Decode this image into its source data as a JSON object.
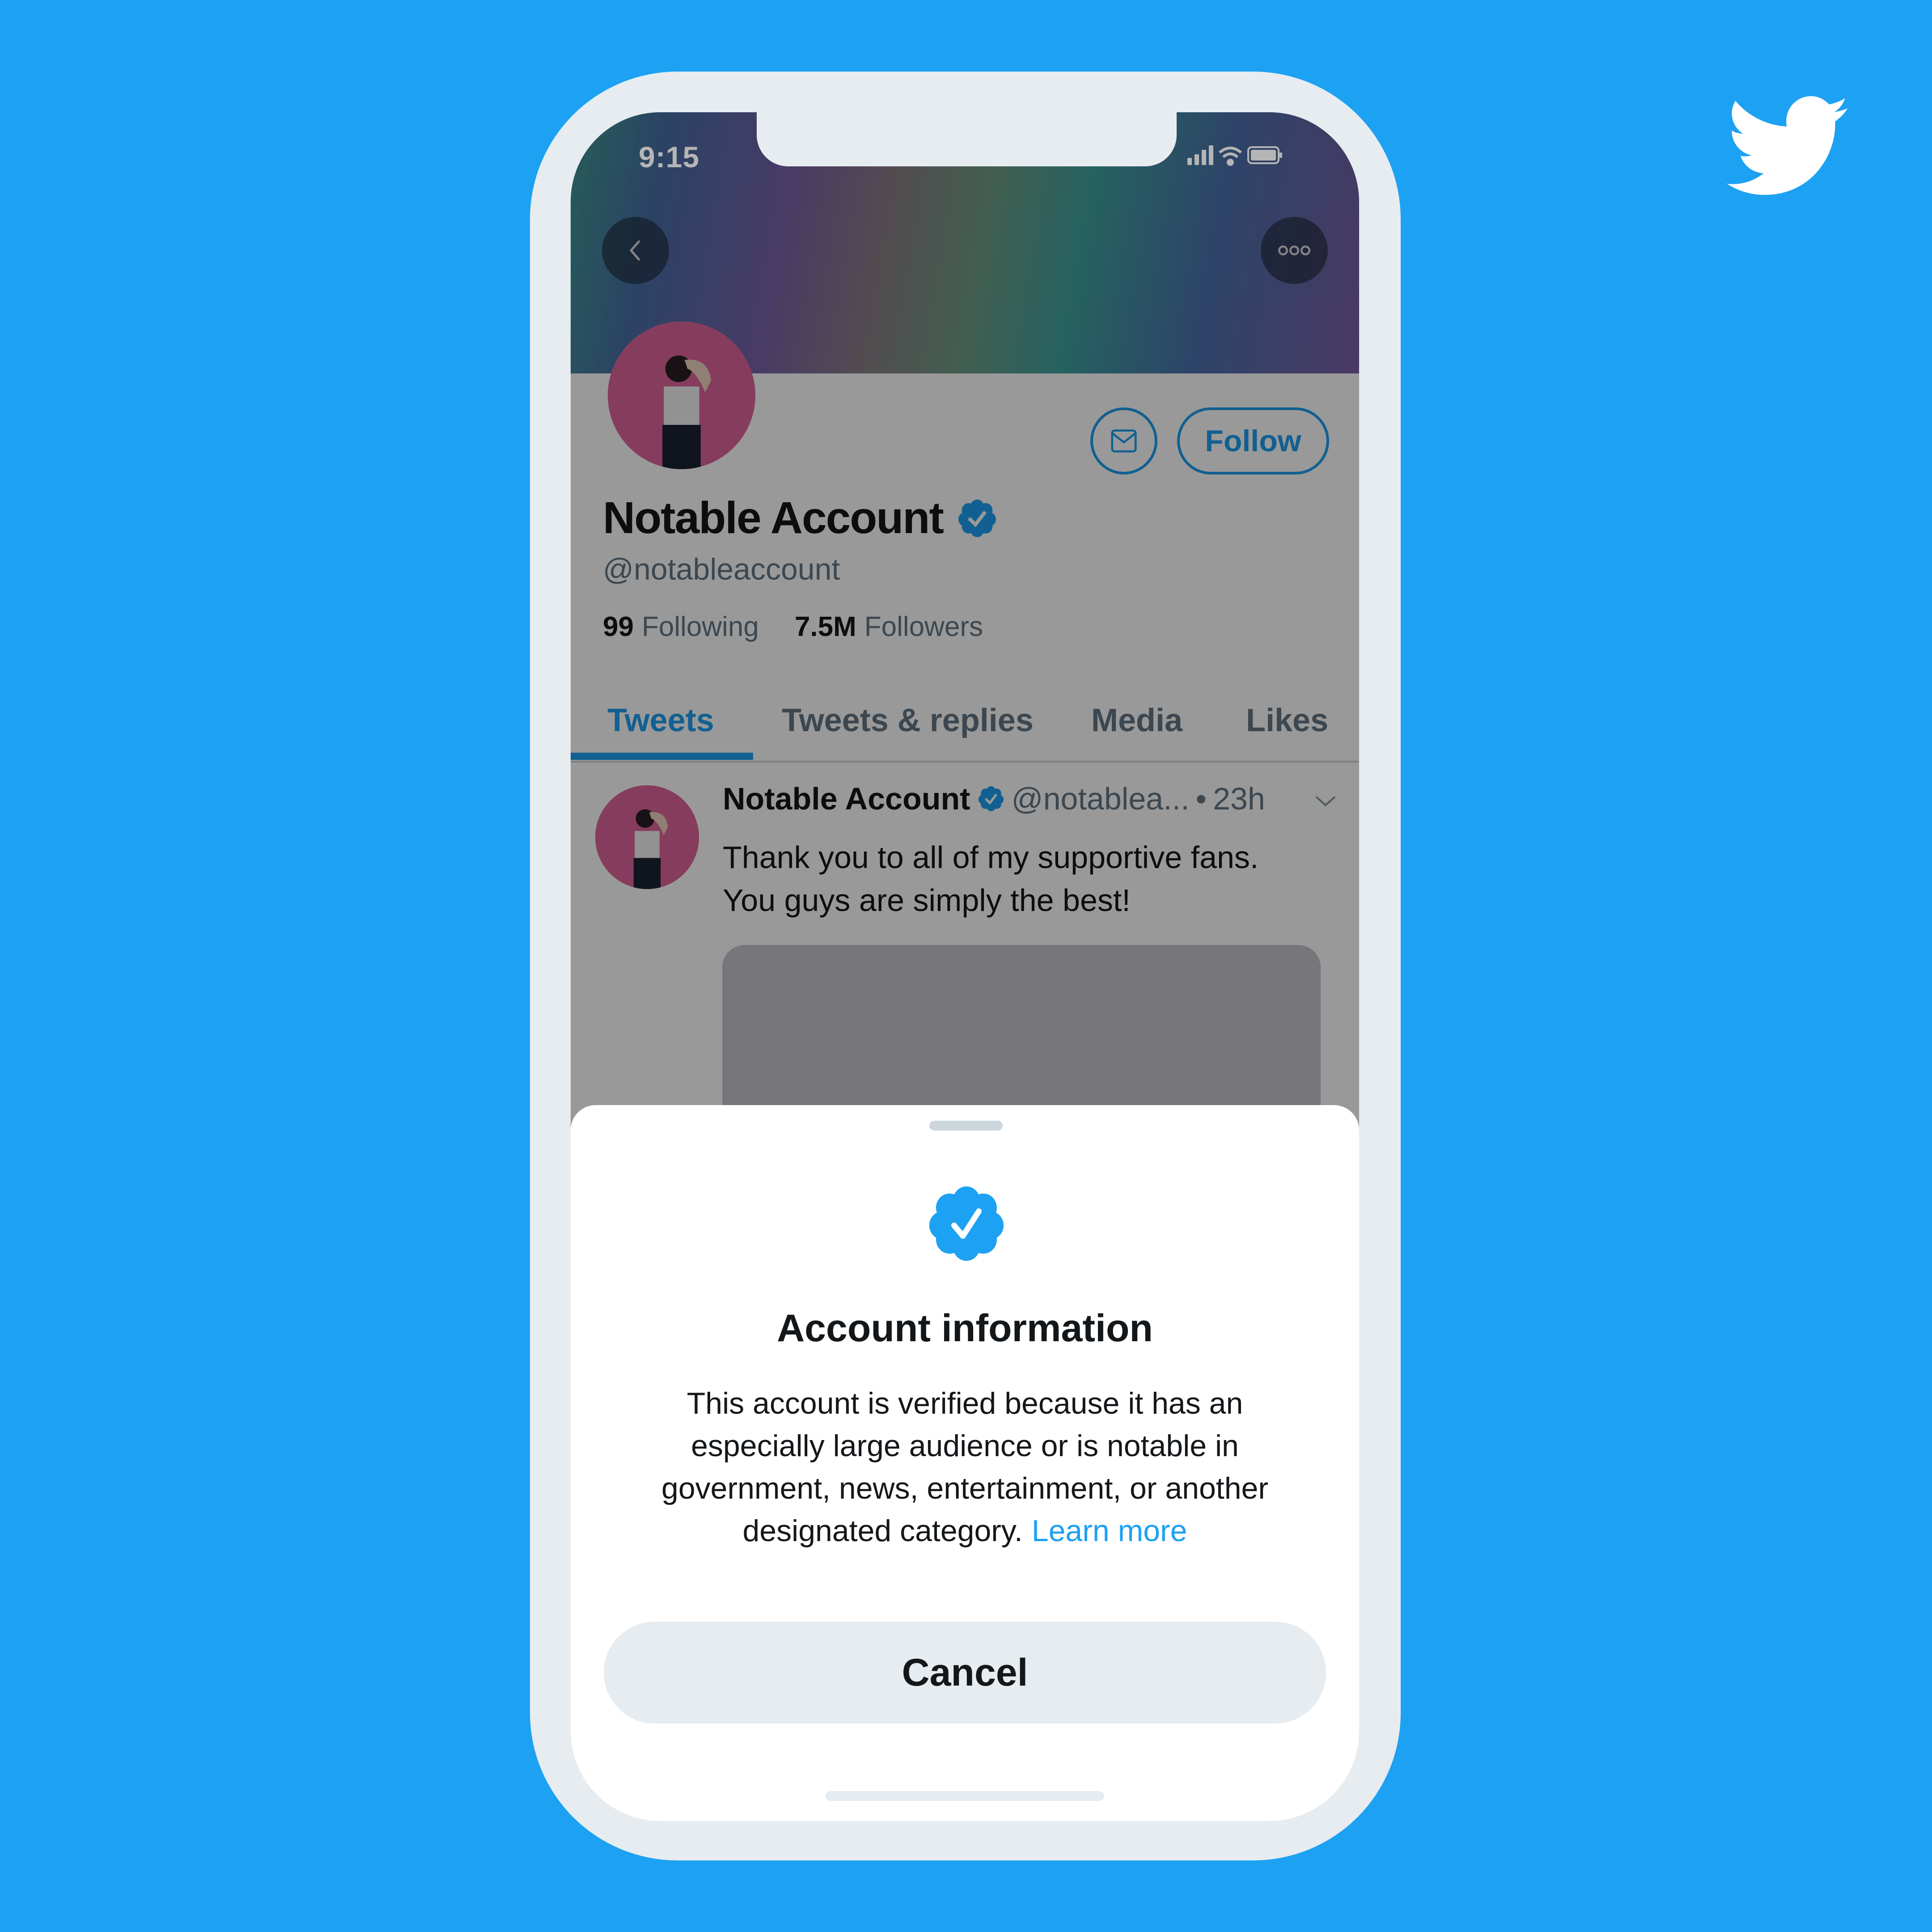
{
  "brand": {
    "logo": "twitter-bird-icon",
    "background_color": "#1DA1F2",
    "accent_color": "#1DA1F2"
  },
  "status_bar": {
    "time": "9:15",
    "icons": [
      "signal-icon",
      "wifi-icon",
      "battery-icon"
    ]
  },
  "profile_header": {
    "back_icon": "chevron-left-icon",
    "more_icon": "more-horizontal-icon"
  },
  "profile": {
    "display_name": "Notable Account",
    "verified": true,
    "handle": "@notableaccount",
    "following_count": "99",
    "following_label": "Following",
    "followers_count": "7.5M",
    "followers_label": "Followers",
    "message_icon": "envelope-icon",
    "follow_label": "Follow"
  },
  "tabs": [
    {
      "label": "Tweets",
      "active": true
    },
    {
      "label": "Tweets & replies",
      "active": false
    },
    {
      "label": "Media",
      "active": false
    },
    {
      "label": "Likes",
      "active": false
    }
  ],
  "tweet": {
    "author": "Notable Account",
    "handle": "@notablea...",
    "separator": "•",
    "time": "23h",
    "text_line1": "Thank you to all of my supportive fans.",
    "text_line2": "You guys are simply the best!"
  },
  "sheet": {
    "badge_icon": "verified-badge-icon",
    "title": "Account information",
    "body": "This account is verified because it has an especially large audience or is notable in government, news, entertainment, or another designated category.",
    "link": "Learn more",
    "cancel_label": "Cancel"
  }
}
